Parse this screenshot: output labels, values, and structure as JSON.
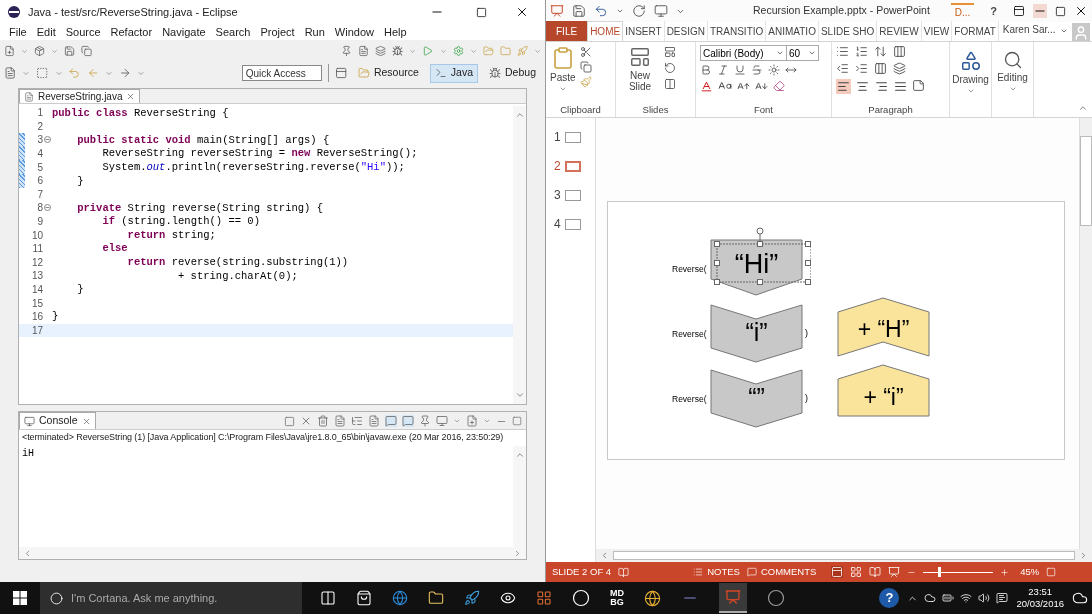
{
  "eclipse": {
    "title": "Java - test/src/ReverseString.java - Eclipse",
    "menu": [
      "File",
      "Edit",
      "Source",
      "Refactor",
      "Navigate",
      "Search",
      "Project",
      "Run",
      "Window",
      "Help"
    ],
    "quick_access": {
      "placeholder": "Quick Access"
    },
    "perspectives": [
      {
        "label": "Resource",
        "selected": false
      },
      {
        "label": "Java",
        "selected": true
      },
      {
        "label": "Debug",
        "selected": false
      }
    ],
    "editor_tab": "ReverseString.java",
    "code_lines": [
      {
        "number": "1",
        "tokens": [
          {
            "kind": "kw",
            "text": "public class"
          },
          {
            "kind": "plain",
            "text": " ReverseString {"
          }
        ],
        "changed": false,
        "current": false,
        "fold": false
      },
      {
        "number": "2",
        "changed": false,
        "current": false,
        "fold": false
      },
      {
        "number": "3",
        "tokens": [
          {
            "kind": "kw",
            "text": "    public static void"
          },
          {
            "kind": "plain",
            "text": " main(String[] args) {"
          }
        ],
        "changed": true,
        "current": false,
        "fold": true
      },
      {
        "number": "4",
        "tokens": [
          {
            "kind": "plain",
            "text": "        ReverseString reverseString = "
          },
          {
            "kind": "kw",
            "text": "new"
          },
          {
            "kind": "plain",
            "text": " ReverseString();"
          }
        ],
        "changed": true,
        "current": false,
        "fold": false
      },
      {
        "number": "5",
        "tokens": [
          {
            "kind": "plain",
            "text": "        System."
          },
          {
            "kind": "field",
            "text": "out"
          },
          {
            "kind": "plain",
            "text": ".println(reverseString.reverse("
          },
          {
            "kind": "string",
            "text": "\"Hi\""
          },
          {
            "kind": "plain",
            "text": "));"
          }
        ],
        "changed": true,
        "current": false,
        "fold": false
      },
      {
        "number": "6",
        "tokens": [
          {
            "kind": "plain",
            "text": "    }"
          }
        ],
        "changed": true,
        "current": false,
        "fold": false
      },
      {
        "number": "7",
        "changed": false,
        "current": false,
        "fold": false
      },
      {
        "number": "8",
        "tokens": [
          {
            "kind": "kw",
            "text": "    private"
          },
          {
            "kind": "plain",
            "text": " String reverse(String string) {"
          }
        ],
        "changed": false,
        "current": false,
        "fold": true
      },
      {
        "number": "9",
        "tokens": [
          {
            "kind": "kw",
            "text": "        if"
          },
          {
            "kind": "plain",
            "text": " (string.length() == 0)"
          }
        ],
        "changed": false,
        "current": false,
        "fold": false
      },
      {
        "number": "10",
        "tokens": [
          {
            "kind": "kw",
            "text": "            return"
          },
          {
            "kind": "plain",
            "text": " string;"
          }
        ],
        "changed": false,
        "current": false,
        "fold": false
      },
      {
        "number": "11",
        "tokens": [
          {
            "kind": "kw",
            "text": "        else"
          }
        ],
        "changed": false,
        "current": false,
        "fold": false
      },
      {
        "number": "12",
        "tokens": [
          {
            "kind": "kw",
            "text": "            return"
          },
          {
            "kind": "plain",
            "text": " reverse(string.substring(1))"
          }
        ],
        "changed": false,
        "current": false,
        "fold": false
      },
      {
        "number": "13",
        "tokens": [
          {
            "kind": "plain",
            "text": "                    + string.charAt(0);"
          }
        ],
        "changed": false,
        "current": false,
        "fold": false
      },
      {
        "number": "14",
        "tokens": [
          {
            "kind": "plain",
            "text": "    }"
          }
        ],
        "changed": false,
        "current": false,
        "fold": false
      },
      {
        "number": "15",
        "changed": false,
        "current": false,
        "fold": false
      },
      {
        "number": "16",
        "tokens": [
          {
            "kind": "plain",
            "text": "}"
          }
        ],
        "changed": false,
        "current": false,
        "fold": false
      },
      {
        "number": "17",
        "changed": false,
        "current": true,
        "fold": false
      }
    ],
    "console": {
      "tab": "Console",
      "header": "<terminated> ReverseString (1) [Java Application] C:\\Program Files\\Java\\jre1.8.0_65\\bin\\javaw.exe (20 Mar 2016, 23:50:29)",
      "output": "iH"
    }
  },
  "powerpoint": {
    "title": "Recursion Example.pptx - PowerPoint",
    "alert": "D...",
    "help": "?",
    "tabs": [
      {
        "label": "FILE",
        "kind": "file",
        "selected": false
      },
      {
        "label": "HOME",
        "kind": "tab",
        "selected": true
      },
      {
        "label": "INSERT",
        "kind": "tab",
        "selected": false
      },
      {
        "label": "DESIGN",
        "kind": "tab",
        "selected": false
      },
      {
        "label": "TRANSITIO",
        "kind": "tab",
        "selected": false
      },
      {
        "label": "ANIMATIO",
        "kind": "tab",
        "selected": false
      },
      {
        "label": "SLIDE SHO",
        "kind": "tab",
        "selected": false
      },
      {
        "label": "REVIEW",
        "kind": "tab",
        "selected": false
      },
      {
        "label": "VIEW",
        "kind": "tab",
        "selected": false
      },
      {
        "label": "FORMAT",
        "kind": "tab",
        "selected": false
      }
    ],
    "user": "Karen Sar...",
    "ribbon": {
      "paste": "Paste",
      "new_slide": "New Slide",
      "font_name": "Calibri (Body)",
      "font_size": "60",
      "drawing": "Drawing",
      "editing": "Editing",
      "align_buttons": [
        {
          "kind": "left",
          "selected": true
        },
        {
          "kind": "center",
          "selected": false
        },
        {
          "kind": "right",
          "selected": false
        },
        {
          "kind": "justify",
          "selected": false
        }
      ],
      "groups": [
        "Clipboard",
        "Slides",
        "Font",
        "Paragraph"
      ]
    },
    "slides": [
      {
        "number": "1",
        "selected": false
      },
      {
        "number": "2",
        "selected": true
      },
      {
        "number": "3",
        "selected": false
      },
      {
        "number": "4",
        "selected": false
      }
    ],
    "slide": {
      "calls": [
        {
          "label": "Reverse(",
          "arg": "“Hi”",
          "kind": "pentagon-down",
          "selected": true
        },
        {
          "label": "Reverse(",
          "arg": "“i”",
          "close": ")",
          "kind": "chevron-down",
          "selected": false
        },
        {
          "label": "Reverse(",
          "arg": "“”",
          "close": ")",
          "kind": "chevron-down",
          "selected": false
        }
      ],
      "results": [
        {
          "text": "+ “H”",
          "kind": "chevron-up"
        },
        {
          "text": "+ “i”",
          "kind": "pentagon-up"
        }
      ]
    },
    "status_bar": {
      "slide": "SLIDE 2 OF 4",
      "notes": "NOTES",
      "comments": "COMMENTS",
      "zoom": "45%",
      "zoom_level": {
        "level": 0.22
      }
    }
  },
  "taskbar": {
    "search": {
      "placeholder": "I'm Cortana. Ask me anything."
    },
    "tile": [
      "MD",
      "BG"
    ],
    "help": "?",
    "time": "23:51",
    "date": "20/03/2016"
  }
}
